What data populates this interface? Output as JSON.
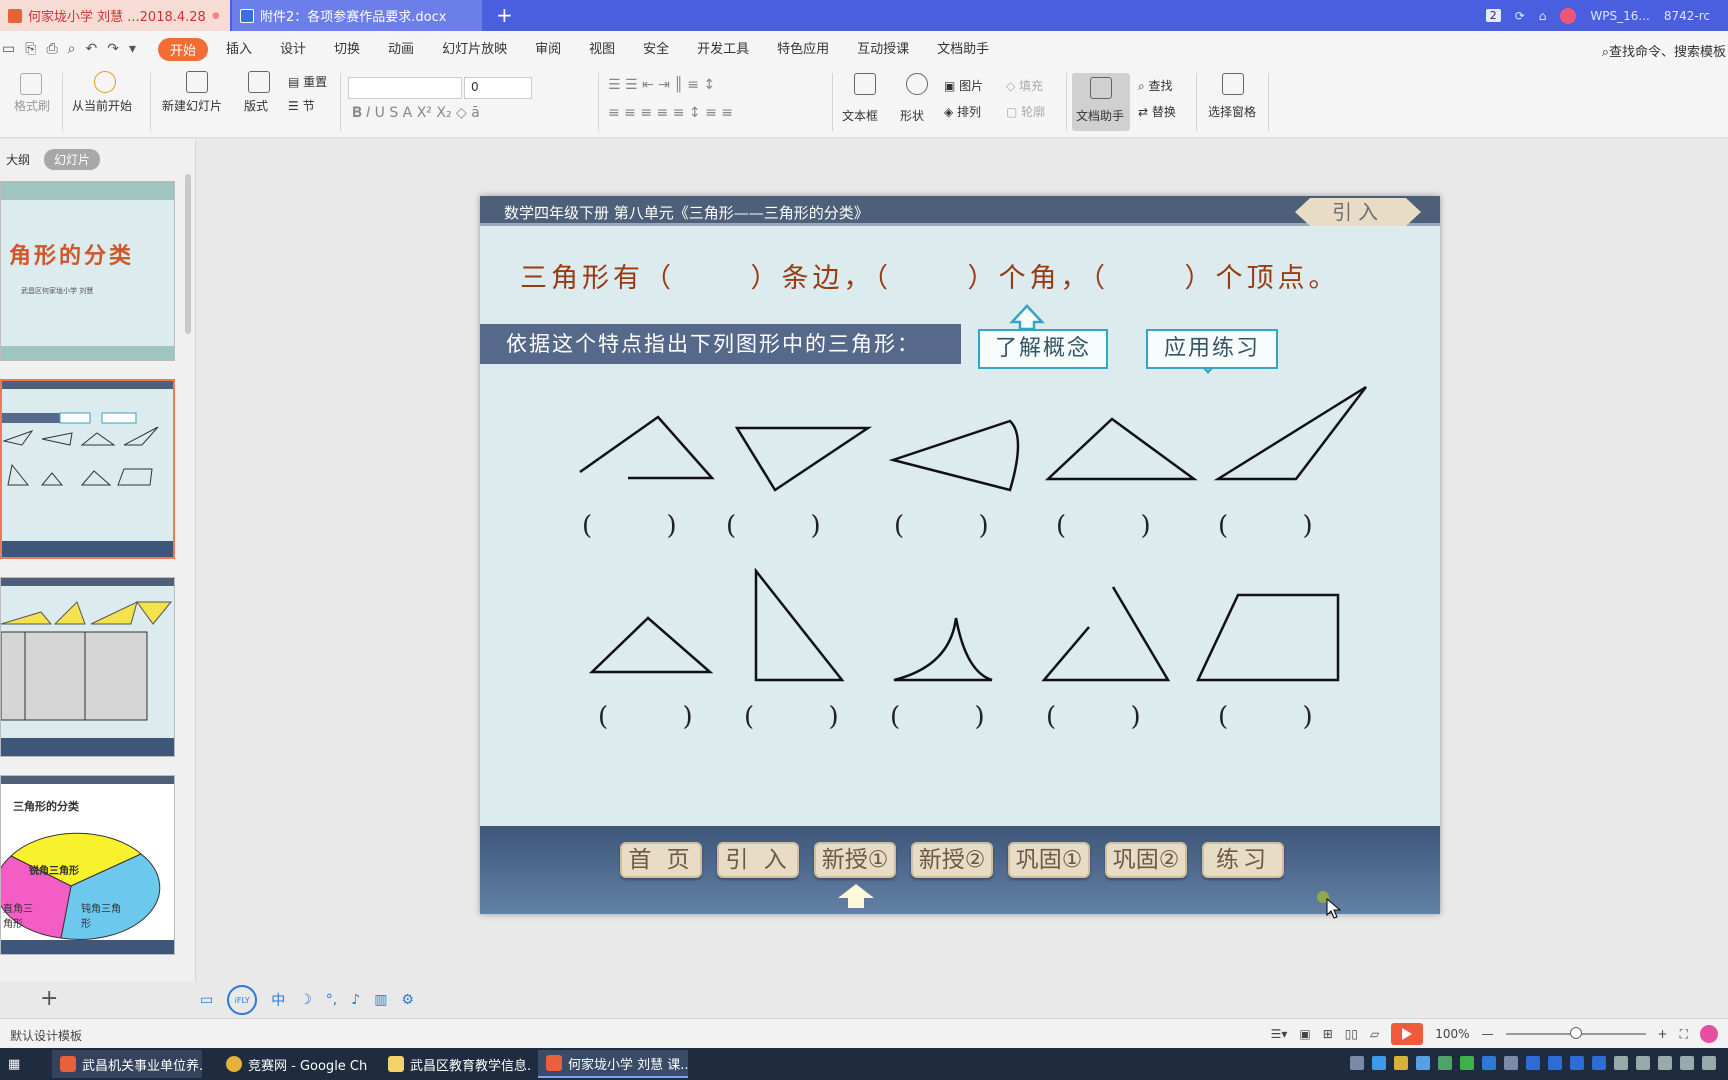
{
  "window": {
    "tab1_title": "何家垅小学 刘慧 ...2018.4.28",
    "tab2_title": "附件2：各项参赛作品要求.docx",
    "page_badge": "2",
    "user_label": "WPS_16...",
    "user_tail": "8742-rc"
  },
  "menu": {
    "items": [
      "开始",
      "插入",
      "设计",
      "切换",
      "动画",
      "幻灯片放映",
      "审阅",
      "视图",
      "安全",
      "开发工具",
      "特色应用",
      "互动授课",
      "文档助手"
    ],
    "search_label": "查找命令、搜索模板"
  },
  "ribbon": {
    "format_painter": "格式刷",
    "play_from_current": "从当前开始",
    "new_slide": "新建幻灯片",
    "layout": "版式",
    "reset": "重置",
    "section": "节",
    "font_size": "0",
    "textbox": "文本框",
    "shape": "形状",
    "picture": "图片",
    "fill": "填充",
    "arrange": "排列",
    "outline": "轮廓",
    "doc_assistant": "文档助手",
    "find": "查找",
    "replace": "替换",
    "selection_pane": "选择窗格"
  },
  "left_panel": {
    "tab_outline": "大纲",
    "tab_slides": "幻灯片",
    "thumb1_title": "角形的分类",
    "thumb1_subtitle": "武昌区何家垅小学  刘慧",
    "thumb4_title": "三角形的分类",
    "thumb4_labels": [
      "锐角三角形",
      "直角三角形",
      "钝角三角形"
    ]
  },
  "slide": {
    "header_title": "数学四年级下册 第八单元《三角形——三角形的分类》",
    "intro_badge": "引入",
    "question": "三角形有（      ）条边，（      ）个角，（      ）个顶点。",
    "instruction": "依据这个特点指出下列图形中的三角形：",
    "concept_button": "了解概念",
    "practice_button": "应用练习",
    "paren": "(         )",
    "nav": [
      "首 页",
      "引 入",
      "新授①",
      "新授②",
      "巩固①",
      "巩固②",
      "练习"
    ]
  },
  "statusbar": {
    "template": "默认设计模板",
    "zoom": "100%"
  },
  "taskbar": {
    "items": [
      "武昌机关事业单位养...",
      "竞赛网 - Google Ch...",
      "武昌区教育教学信息...",
      "何家垅小学 刘慧 课..."
    ]
  },
  "colors": {
    "accent": "#f26d35",
    "slide_bg": "#dcebee",
    "slide_header": "#4e5f79",
    "question_text": "#9a3a12",
    "concept_border": "#35a3c4"
  }
}
